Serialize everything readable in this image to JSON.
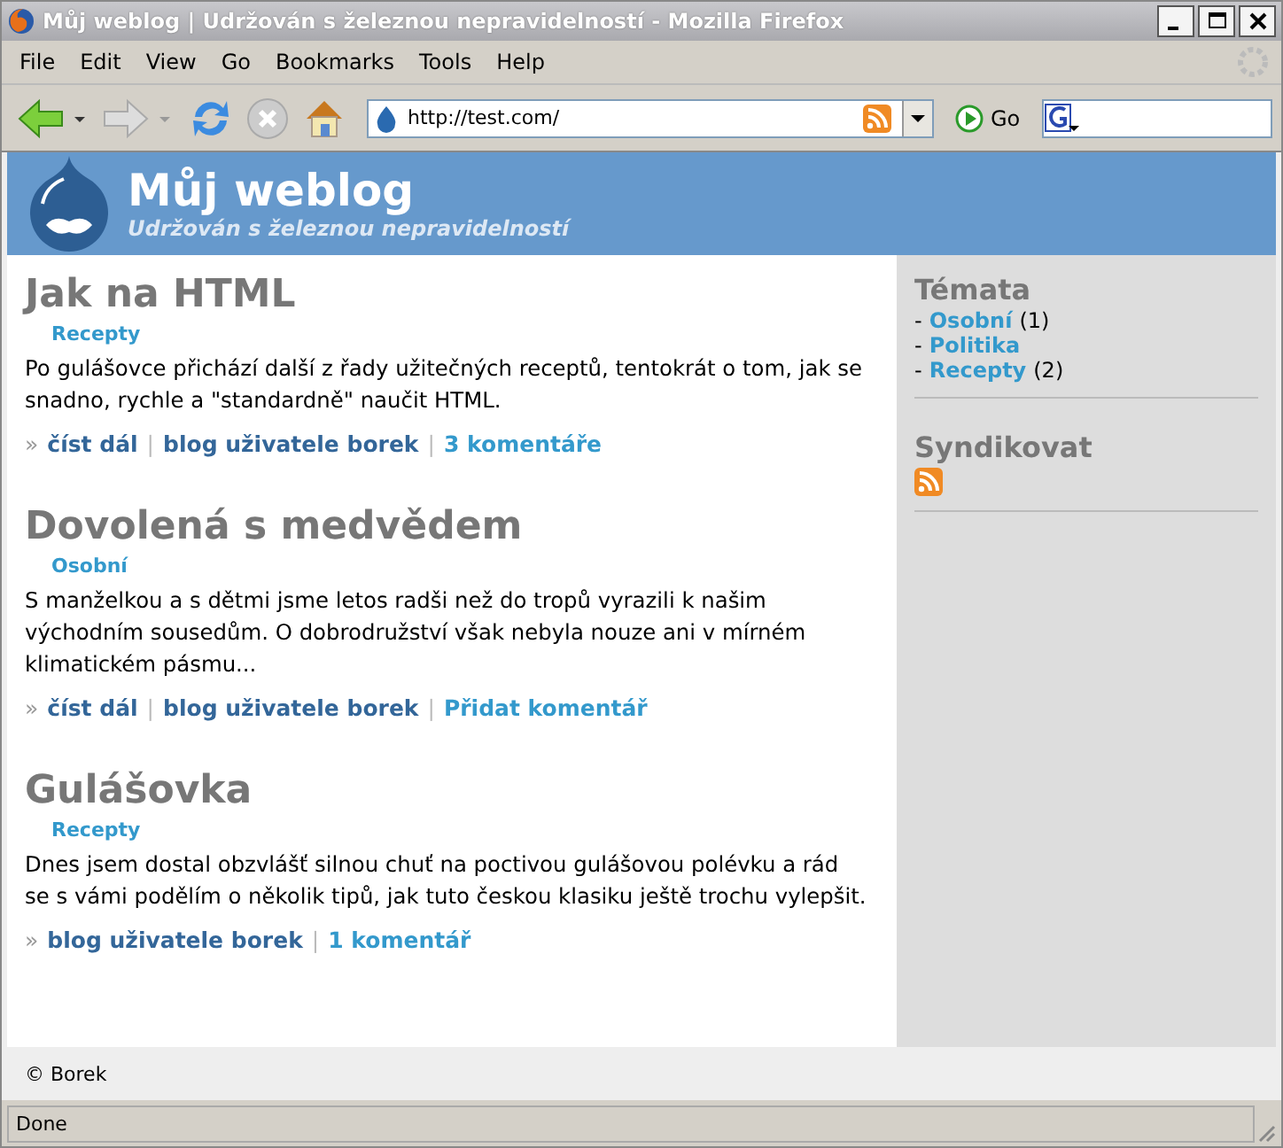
{
  "window": {
    "title": "Můj weblog | Udržován s železnou nepravidelností - Mozilla Firefox"
  },
  "menu": [
    "File",
    "Edit",
    "View",
    "Go",
    "Bookmarks",
    "Tools",
    "Help"
  ],
  "address": {
    "value": "http://test.com/"
  },
  "go_button": "Go",
  "site": {
    "name": "Můj weblog",
    "slogan": "Udržován s železnou nepravidelností"
  },
  "posts": [
    {
      "title": "Jak na HTML",
      "category": "Recepty",
      "body": "Po gulášovce přichází další z řady užitečných receptů, tentokrát o tom, jak se snadno, rychle a \"standardně\" naučit HTML.",
      "prefix": "»",
      "links": [
        {
          "text": "číst dál",
          "kind": "read"
        },
        {
          "separator": "|",
          "text": "blog uživatele borek",
          "kind": "blog"
        },
        {
          "separator": "|",
          "text": "3 komentáře",
          "kind": "comments"
        }
      ]
    },
    {
      "title": "Dovolená s medvědem",
      "category": "Osobní",
      "body": "S manželkou a s dětmi jsme letos radši než do tropů vyrazili k našim východním sousedům. O dobrodružství však nebyla nouze ani v mírném klimatickém pásmu...",
      "prefix": "»",
      "links": [
        {
          "text": "číst dál",
          "kind": "read"
        },
        {
          "separator": "|",
          "text": "blog uživatele borek",
          "kind": "blog"
        },
        {
          "separator": "|",
          "text": "Přidat komentář",
          "kind": "comments"
        }
      ]
    },
    {
      "title": "Gulášovka",
      "category": "Recepty",
      "body": "Dnes jsem dostal obzvlášť silnou chuť na poctivou gulášovou polévku a rád se s vámi podělím o několik tipů, jak tuto českou klasiku ještě trochu vylepšit.",
      "prefix": "»",
      "links": [
        {
          "text": "blog uživatele borek",
          "kind": "blog"
        },
        {
          "separator": "|",
          "text": "1 komentář",
          "kind": "comments"
        }
      ]
    }
  ],
  "sidebar": {
    "topics_title": "Témata",
    "topics": [
      {
        "dash": "-",
        "label": "Osobní",
        "count": "(1)"
      },
      {
        "dash": "-",
        "label": "Politika"
      },
      {
        "dash": "-",
        "label": "Recepty",
        "count": "(2)"
      }
    ],
    "syndicate_title": "Syndikovat"
  },
  "footer": "© Borek",
  "status_bar": "Done"
}
